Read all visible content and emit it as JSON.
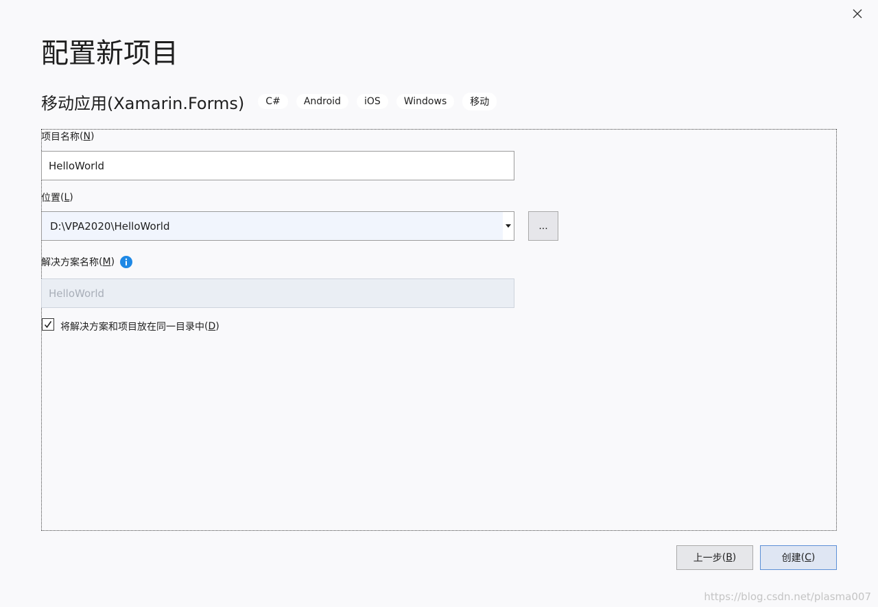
{
  "dialog": {
    "title": "配置新项目",
    "template_name": "移动应用(Xamarin.Forms)",
    "tags": [
      "C#",
      "Android",
      "iOS",
      "Windows",
      "移动"
    ]
  },
  "form": {
    "project_name": {
      "label": "项目名称",
      "key": "N",
      "value": "HelloWorld"
    },
    "location": {
      "label": "位置",
      "key": "L",
      "value": "D:\\VPA2020\\HelloWorld",
      "browse_label": "...",
      "browse_key": "."
    },
    "solution_name": {
      "label": "解决方案名称",
      "key": "M",
      "value": "HelloWorld"
    },
    "same_dir": {
      "label": "将解决方案和项目放在同一目录中",
      "key": "D",
      "checked": true
    }
  },
  "footer": {
    "back": {
      "label": "上一步",
      "key": "B"
    },
    "create": {
      "label": "创建",
      "key": "C"
    }
  },
  "watermark": "https://blog.csdn.net/plasma007",
  "colors": {
    "accent": "#5b8fd6",
    "info_icon": "#1e88e5",
    "background": "#f9f9fb"
  }
}
